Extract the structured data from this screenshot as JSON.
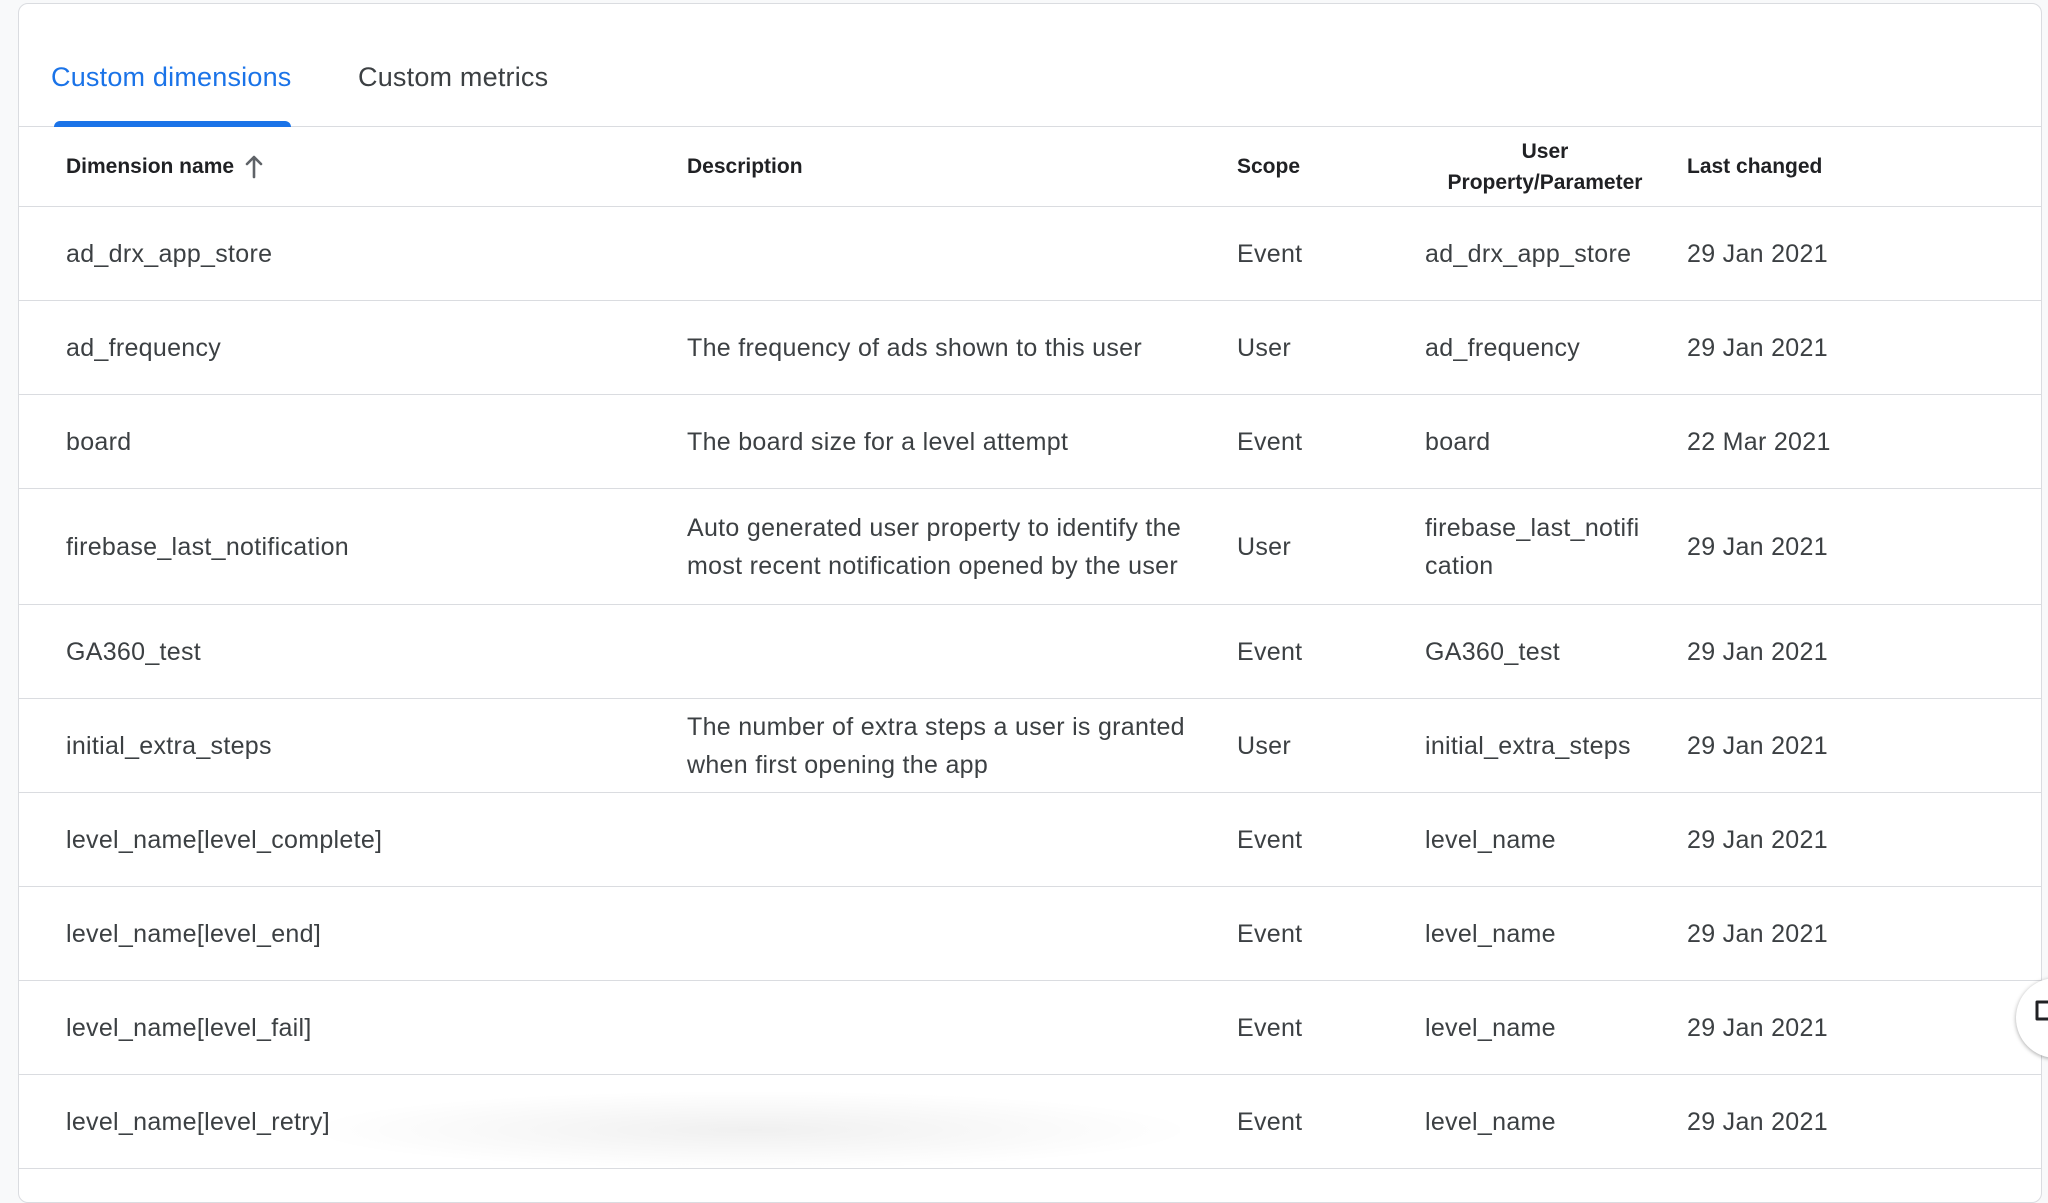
{
  "tabs": {
    "dimensions_label": "Custom dimensions",
    "metrics_label": "Custom metrics",
    "active": "dimensions"
  },
  "colors": {
    "accent": "#1a73e8",
    "text_primary": "#202124",
    "text_secondary": "#3c4043",
    "divider": "#dadce0"
  },
  "table": {
    "headers": {
      "name": "Dimension name",
      "description": "Description",
      "scope": "Scope",
      "param_line1": "User",
      "param_line2": "Property/Parameter",
      "changed": "Last changed"
    },
    "sort": {
      "column": "name",
      "direction": "ascending",
      "icon": "arrow-up-icon"
    },
    "rows": [
      {
        "name": "ad_drx_app_store",
        "description": "",
        "scope": "Event",
        "param": "ad_drx_app_store",
        "changed": "29 Jan 2021"
      },
      {
        "name": "ad_frequency",
        "description": "The frequency of ads shown to this user",
        "scope": "User",
        "param": "ad_frequency",
        "changed": "29 Jan 2021"
      },
      {
        "name": "board",
        "description": "The board size for a level attempt",
        "scope": "Event",
        "param": "board",
        "changed": "22 Mar 2021"
      },
      {
        "name": "firebase_last_notification",
        "description": "Auto generated user property to identify the most recent notification opened by the user",
        "scope": "User",
        "param": "firebase_last_notification",
        "changed": "29 Jan 2021"
      },
      {
        "name": "GA360_test",
        "description": "",
        "scope": "Event",
        "param": "GA360_test",
        "changed": "29 Jan 2021"
      },
      {
        "name": "initial_extra_steps",
        "description": "The number of extra steps a user is granted when first opening the app",
        "scope": "User",
        "param": "initial_extra_steps",
        "changed": "29 Jan 2021"
      },
      {
        "name": "level_name[level_complete]",
        "description": "",
        "scope": "Event",
        "param": "level_name",
        "changed": "29 Jan 2021"
      },
      {
        "name": "level_name[level_end]",
        "description": "",
        "scope": "Event",
        "param": "level_name",
        "changed": "29 Jan 2021"
      },
      {
        "name": "level_name[level_fail]",
        "description": "",
        "scope": "Event",
        "param": "level_name",
        "changed": "29 Jan 2021"
      },
      {
        "name": "level_name[level_retry]",
        "description": "",
        "scope": "Event",
        "param": "level_name",
        "changed": "29 Jan 2021"
      }
    ]
  },
  "feedback": {
    "icon": "feedback-icon"
  }
}
